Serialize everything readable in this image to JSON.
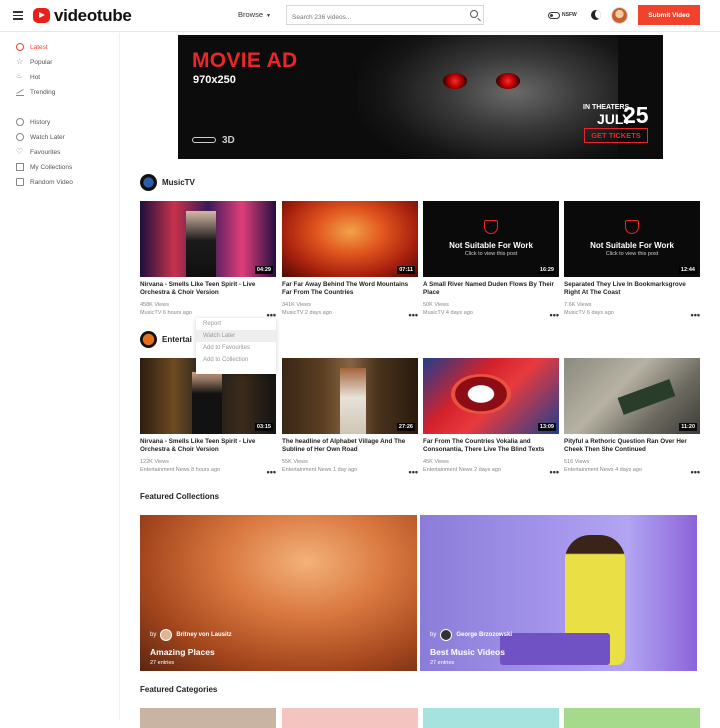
{
  "header": {
    "logo": "videotube",
    "browse_label": "Browse",
    "search_placeholder": "Search 236 videos...",
    "nsfw_label": "NSFW",
    "submit_label": "Submit Video"
  },
  "sidebar": {
    "items": [
      {
        "label": "Latest",
        "icon": "clock-icon",
        "active": true
      },
      {
        "label": "Popular",
        "icon": "star-icon"
      },
      {
        "label": "Hot",
        "icon": "fire-icon"
      },
      {
        "label": "Trending",
        "icon": "trending-icon"
      },
      {
        "label": "History",
        "icon": "history-icon"
      },
      {
        "label": "Watch Later",
        "icon": "watch-later-icon"
      },
      {
        "label": "Favourites",
        "icon": "heart-icon"
      },
      {
        "label": "My Collections",
        "icon": "collection-icon"
      },
      {
        "label": "Random Video",
        "icon": "random-icon"
      }
    ]
  },
  "ad": {
    "title": "MOVIE AD",
    "size": "970x250",
    "brand": "3D",
    "in_theaters": "IN THEATERS",
    "month": "JULY",
    "day": "25",
    "cta": "GET TICKETS"
  },
  "sections": [
    {
      "title": "MusicTV",
      "videos": [
        {
          "title": "Nirvana - Smells Like Teen Spirit - Live Orchestra & Choir Version",
          "views": "458K Views",
          "channel": "MusicTV",
          "age": "6 hours ago",
          "duration": "04:29"
        },
        {
          "title": "Far Far Away Behind The Word Mountains Far From The Countries",
          "views": "341K Views",
          "channel": "MusicTV",
          "age": "2 days ago",
          "duration": "07:11"
        },
        {
          "title": "A Small River Named Duden Flows By Their Place",
          "views": "50K Views",
          "channel": "MusicTV",
          "age": "4 days ago",
          "duration": "16:29",
          "nsfw_title": "Not Suitable For Work",
          "nsfw_sub": "Click to view this post"
        },
        {
          "title": "Separated They Live In Bookmarksgrove Right At The Coast",
          "views": "7.6K Views",
          "channel": "MusicTV",
          "age": "6 days ago",
          "duration": "12:44",
          "nsfw_title": "Not Suitable For Work",
          "nsfw_sub": "Click to view this post"
        }
      ]
    },
    {
      "title": "Entertai",
      "videos": [
        {
          "title": "Nirvana - Smells Like Teen Spirit - Live Orchestra & Choir Version",
          "views": "122K Views",
          "channel": "Entertainment News",
          "age": "8 hours ago",
          "duration": "03:15"
        },
        {
          "title": "The headline of Alphabet Village And The Subline of Her Own Road",
          "views": "55K Views",
          "channel": "Entertainment News",
          "age": "1 day ago",
          "duration": "27:26"
        },
        {
          "title": "Far From The Countries Vokalia and Consonantia, There Live The Blind Texts",
          "views": "45K Views",
          "channel": "Entertainment News",
          "age": "2 days ago",
          "duration": "13:09"
        },
        {
          "title": "Pityful a Rethoric Question Ran Over Her Cheek Then She Continued",
          "views": "516 Views",
          "channel": "Entertainment News",
          "age": "4 days ago",
          "duration": "11:20"
        }
      ]
    }
  ],
  "context_menu": [
    "Report",
    "Watch Later",
    "Add to Favourites",
    "Add to Collection"
  ],
  "featured_collections": {
    "title": "Featured Collections",
    "items": [
      {
        "by": "by",
        "user": "Britney von Lausitz",
        "title": "Amazing Places",
        "count": "27 entries"
      },
      {
        "by": "by",
        "user": "George Brzozowski",
        "title": "Best Music Videos",
        "count": "27 entries"
      }
    ]
  },
  "featured_categories": {
    "title": "Featured Categories",
    "colors": [
      "#c9b4a4",
      "#f4c4c0",
      "#a7e3de",
      "#a5d98c"
    ]
  },
  "colors": {
    "accent": "#f0422c",
    "logo_red": "#e62117"
  }
}
